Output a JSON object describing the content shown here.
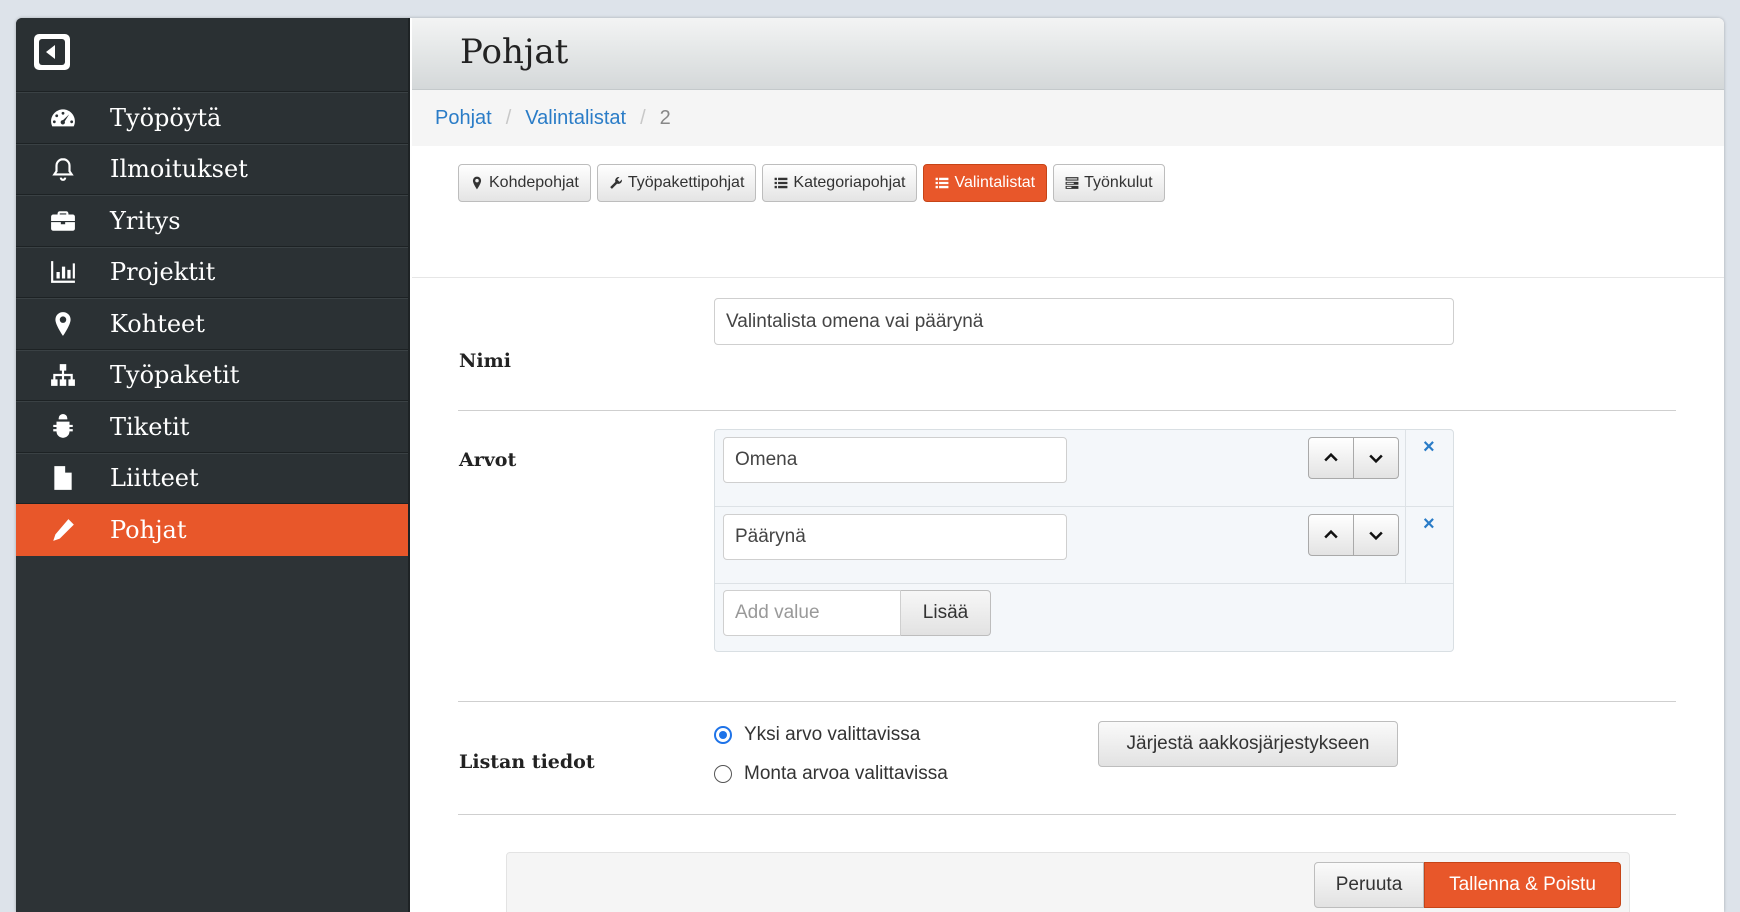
{
  "sidebar": {
    "toggle_icon": "collapse-left-icon",
    "items": [
      {
        "label": "Työpöytä",
        "icon": "dashboard-icon",
        "active": false
      },
      {
        "label": "Ilmoitukset",
        "icon": "bell-icon",
        "active": false
      },
      {
        "label": "Yritys",
        "icon": "briefcase-icon",
        "active": false
      },
      {
        "label": "Projektit",
        "icon": "bar-chart-icon",
        "active": false
      },
      {
        "label": "Kohteet",
        "icon": "map-marker-icon",
        "active": false
      },
      {
        "label": "Työpaketit",
        "icon": "sitemap-icon",
        "active": false
      },
      {
        "label": "Tiketit",
        "icon": "bug-icon",
        "active": false
      },
      {
        "label": "Liitteet",
        "icon": "file-icon",
        "active": false
      },
      {
        "label": "Pohjat",
        "icon": "pencil-icon",
        "active": true
      }
    ]
  },
  "header": {
    "title": "Pohjat"
  },
  "breadcrumb": {
    "items": [
      "Pohjat",
      "Valintalistat"
    ],
    "current": "2",
    "separator": "/"
  },
  "subtabs": [
    {
      "label": "Kohdepohjat",
      "icon": "map-marker-icon",
      "active": false
    },
    {
      "label": "Työpakettipohjat",
      "icon": "wrench-icon",
      "active": false
    },
    {
      "label": "Kategoriapohjat",
      "icon": "list-icon",
      "active": false
    },
    {
      "label": "Valintalistat",
      "icon": "list-icon",
      "active": true
    },
    {
      "label": "Työnkulut",
      "icon": "tasks-icon",
      "active": false
    }
  ],
  "form": {
    "name_label": "Nimi",
    "name_value": "Valintalista omena vai päärynä",
    "values_label": "Arvot",
    "values": [
      "Omena",
      "Päärynä"
    ],
    "remove_symbol": "×",
    "add_placeholder": "Add value",
    "add_button": "Lisää",
    "list_info_label": "Listan tiedot",
    "radio_single": "Yksi arvo valittavissa",
    "radio_multi": "Monta arvoa valittavissa",
    "selected_mode": "single",
    "sort_button": "Järjestä aakkosjärjestykseen",
    "cancel_button": "Peruuta",
    "save_button": "Tallenna & Poistu"
  },
  "colors": {
    "accent": "#e8572a",
    "link": "#2a7cc7",
    "sidebar_bg": "#2d3336",
    "radio": "#1e73e8"
  }
}
